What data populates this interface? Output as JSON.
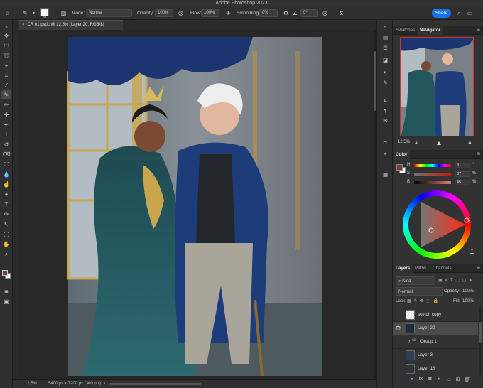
{
  "app": {
    "title": "Adobe Photoshop 2023"
  },
  "options": {
    "brush_size": "31",
    "mode_label": "Mode:",
    "mode_value": "Normal",
    "opacity_label": "Opacity:",
    "opacity_value": "100%",
    "flow_label": "Flow:",
    "flow_value": "100%",
    "smoothing_label": "Smoothing:",
    "smoothing_value": "0%",
    "angle_value": "0°",
    "share_label": "Share"
  },
  "document": {
    "tab_title": "CR 01.psdc @ 12,5% (Layer 20, RGB/8)",
    "zoom": "12,5%",
    "info": "5400 px x 7200 px (300 ppi)"
  },
  "navigator": {
    "tabs": [
      "Swatches",
      "Navigator"
    ],
    "active_tab": "Navigator",
    "zoom": "12,5%"
  },
  "color": {
    "tab": "Color",
    "rows": [
      {
        "label": "H",
        "value": "8",
        "unit": "°"
      },
      {
        "label": "S",
        "value": "37",
        "unit": "%"
      },
      {
        "label": "B",
        "value": "45",
        "unit": "%"
      }
    ],
    "foreground": "#733f3b",
    "background": "#ffffff"
  },
  "layers": {
    "tabs": [
      "Layers",
      "Paths",
      "Channels"
    ],
    "active_tab": "Layers",
    "filter": "Kind",
    "blend_mode": "Normal",
    "opacity_label": "Opacity:",
    "opacity_value": "100%",
    "lock_label": "Lock:",
    "fill_label": "Fill:",
    "fill_value": "100%",
    "items": [
      {
        "name": "sketch copy",
        "visible": false,
        "selected": false,
        "type": "layer"
      },
      {
        "name": "Layer 20",
        "visible": true,
        "selected": true,
        "type": "layer"
      },
      {
        "name": "Group 1",
        "visible": false,
        "selected": false,
        "type": "group"
      },
      {
        "name": "Layer 3",
        "visible": false,
        "selected": false,
        "type": "layer"
      },
      {
        "name": "Layer 16",
        "visible": false,
        "selected": false,
        "type": "layer"
      }
    ]
  },
  "colors": {
    "accent": "#1473e6",
    "selection": "#4a4a4a",
    "navigator_frame": "#d9322d"
  }
}
